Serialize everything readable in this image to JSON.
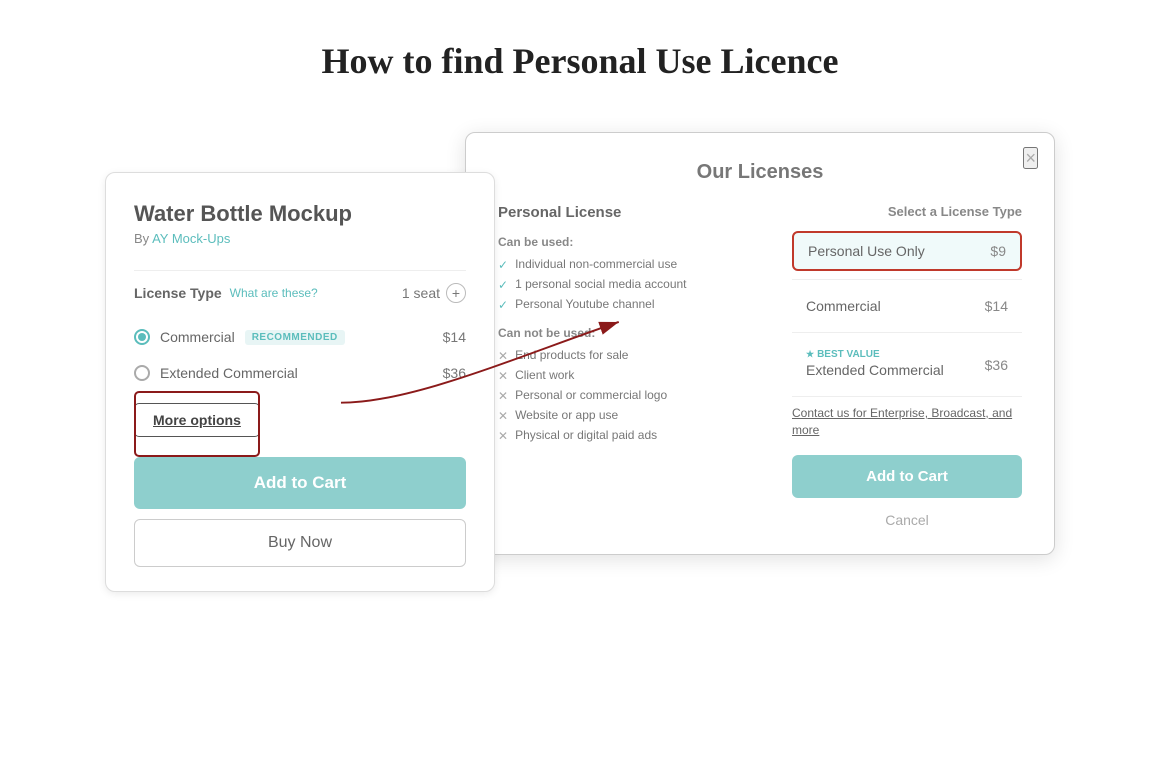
{
  "page": {
    "title": "How to find Personal Use Licence"
  },
  "product_card": {
    "title": "Water Bottle Mockup",
    "author_prefix": "By ",
    "author_name": "AY Mock-Ups",
    "license_label": "License Type",
    "what_label": "What are these?",
    "seat_label": "1 seat",
    "options": [
      {
        "name": "Commercial",
        "badge": "RECOMMENDED",
        "price": "$14",
        "selected": true
      },
      {
        "name": "Extended Commercial",
        "badge": "",
        "price": "$36",
        "selected": false
      }
    ],
    "more_options": "More options",
    "add_cart": "Add to Cart",
    "buy_now": "Buy Now"
  },
  "modal": {
    "title": "Our Licenses",
    "close": "×",
    "left": {
      "personal_license_title": "Personal License",
      "can_be_used_title": "Can be used:",
      "can_be_used": [
        "Individual non-commercial use",
        "1 personal social media account",
        "Personal Youtube channel"
      ],
      "cannot_be_used_title": "Can not be used:",
      "cannot_be_used": [
        "End products for sale",
        "Client work",
        "Personal or commercial logo",
        "Website or app use",
        "Physical or digital paid ads"
      ]
    },
    "right": {
      "select_title": "Select a License Type",
      "personal_use_only": "Personal Use Only",
      "personal_price": "$9",
      "commercial": "Commercial",
      "commercial_price": "$14",
      "best_value_label": "BEST VALUE",
      "extended": "Extended Commercial",
      "extended_price": "$36",
      "enterprise_link": "Contact us for Enterprise, Broadcast, and more",
      "add_cart": "Add to Cart",
      "cancel": "Cancel"
    }
  }
}
